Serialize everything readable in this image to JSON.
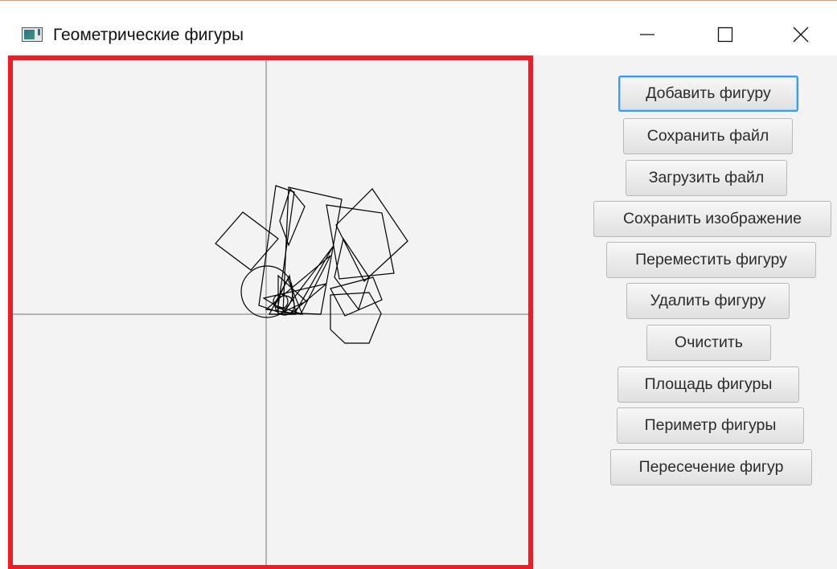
{
  "window": {
    "title": "Геометрические фигуры",
    "app_icon": "app-window-icon",
    "controls": {
      "minimize_icon": "minimize-icon",
      "maximize_icon": "maximize-icon",
      "close_icon": "close-icon"
    }
  },
  "canvas": {
    "border_color": "#ee1c25",
    "background": "#f3f3f3",
    "axis_color": "#b3b3b3",
    "shape_color": "#000000"
  },
  "buttons": [
    {
      "id": "add-shape",
      "label": "Добавить фигуру",
      "focused": true
    },
    {
      "id": "save-file",
      "label": "Сохранить файл"
    },
    {
      "id": "load-file",
      "label": "Загрузить файл"
    },
    {
      "id": "save-image",
      "label": "Сохранить изображение"
    },
    {
      "id": "move-shape",
      "label": "Переместить фигуру"
    },
    {
      "id": "delete-shape",
      "label": "Удалить фигуру"
    },
    {
      "id": "clear",
      "label": "Очистить"
    },
    {
      "id": "shape-area",
      "label": "Площадь фигуры"
    },
    {
      "id": "shape-perimeter",
      "label": "Периметр фигуры"
    },
    {
      "id": "shape-intersection",
      "label": "Пересечение фигур"
    }
  ],
  "colors": {
    "focus_ring": "#3b99fc",
    "button_border": "#b9b9b9"
  }
}
